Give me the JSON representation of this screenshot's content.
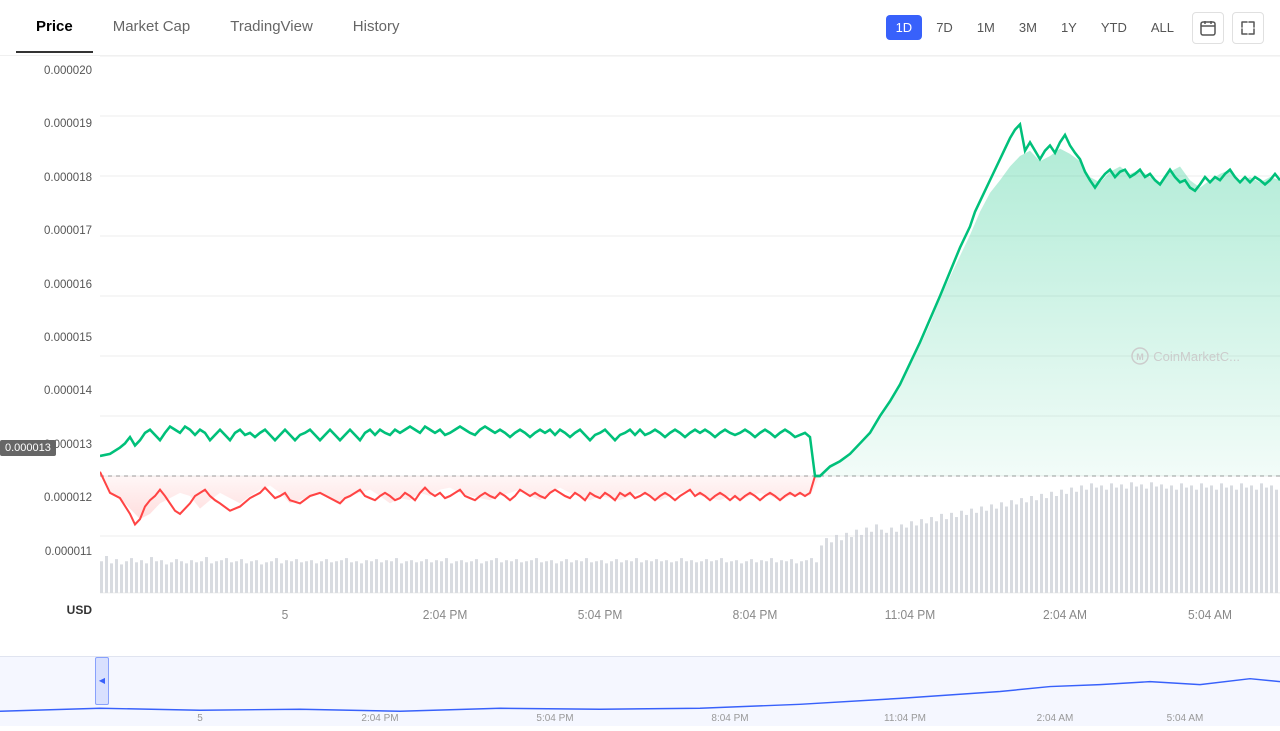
{
  "nav": {
    "tabs": [
      {
        "label": "Price",
        "active": true
      },
      {
        "label": "Market Cap",
        "active": false
      },
      {
        "label": "TradingView",
        "active": false
      },
      {
        "label": "History",
        "active": false
      }
    ]
  },
  "timeControls": {
    "buttons": [
      {
        "label": "1D",
        "active": true
      },
      {
        "label": "7D",
        "active": false
      },
      {
        "label": "1M",
        "active": false
      },
      {
        "label": "3M",
        "active": false
      },
      {
        "label": "1Y",
        "active": false
      },
      {
        "label": "YTD",
        "active": false
      },
      {
        "label": "ALL",
        "active": false
      }
    ]
  },
  "yAxis": {
    "labels": [
      "0.000020",
      "0.000019",
      "0.000018",
      "0.000017",
      "0.000016",
      "0.000015",
      "0.000014",
      "0.000013",
      "0.000012",
      "0.000011"
    ]
  },
  "xAxis": {
    "labels": [
      "5",
      "2:04 PM",
      "5:04 PM",
      "8:04 PM",
      "11:04 PM",
      "2:04 AM",
      "5:04 AM"
    ]
  },
  "priceMarker": {
    "value": "0.000013",
    "label": "0.000013"
  },
  "watermark": "CoinMarketC...",
  "currency": "USD"
}
